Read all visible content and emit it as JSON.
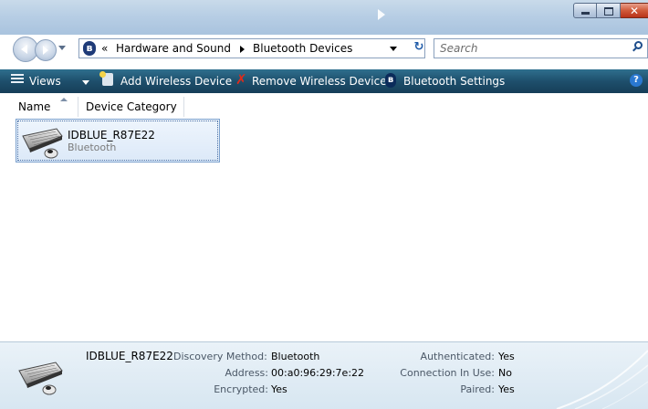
{
  "window": {
    "caption_buttons": [
      "minimize",
      "maximize",
      "close"
    ]
  },
  "navigation": {
    "breadcrumb_prefix": "«",
    "breadcrumbs": [
      "Hardware and Sound",
      "Bluetooth Devices"
    ],
    "search_placeholder": "Search"
  },
  "toolbar": {
    "views_label": "Views",
    "add_label": "Add Wireless Device",
    "remove_label": "Remove Wireless Device",
    "settings_label": "Bluetooth Settings"
  },
  "columns": {
    "name": "Name",
    "category": "Device Category"
  },
  "devices": [
    {
      "name": "IDBLUE_R87E22",
      "category": "Bluetooth",
      "icon": "keyboard-mouse-icon"
    }
  ],
  "details": {
    "device_name": "IDBLUE_R87E22",
    "discovery_method_label": "Discovery Method:",
    "discovery_method": "Bluetooth",
    "address_label": "Address:",
    "address": "00:a0:96:29:7e:22",
    "encrypted_label": "Encrypted:",
    "encrypted": "Yes",
    "authenticated_label": "Authenticated:",
    "authenticated": "Yes",
    "connection_label": "Connection In Use:",
    "connection_in_use": "No",
    "paired_label": "Paired:",
    "paired": "Yes"
  },
  "colors": {
    "toolbar": "#1e4f6c",
    "selection_border": "#7da2ce",
    "selection_fill": "#dce9f8",
    "details_background": "#e2edf5"
  }
}
